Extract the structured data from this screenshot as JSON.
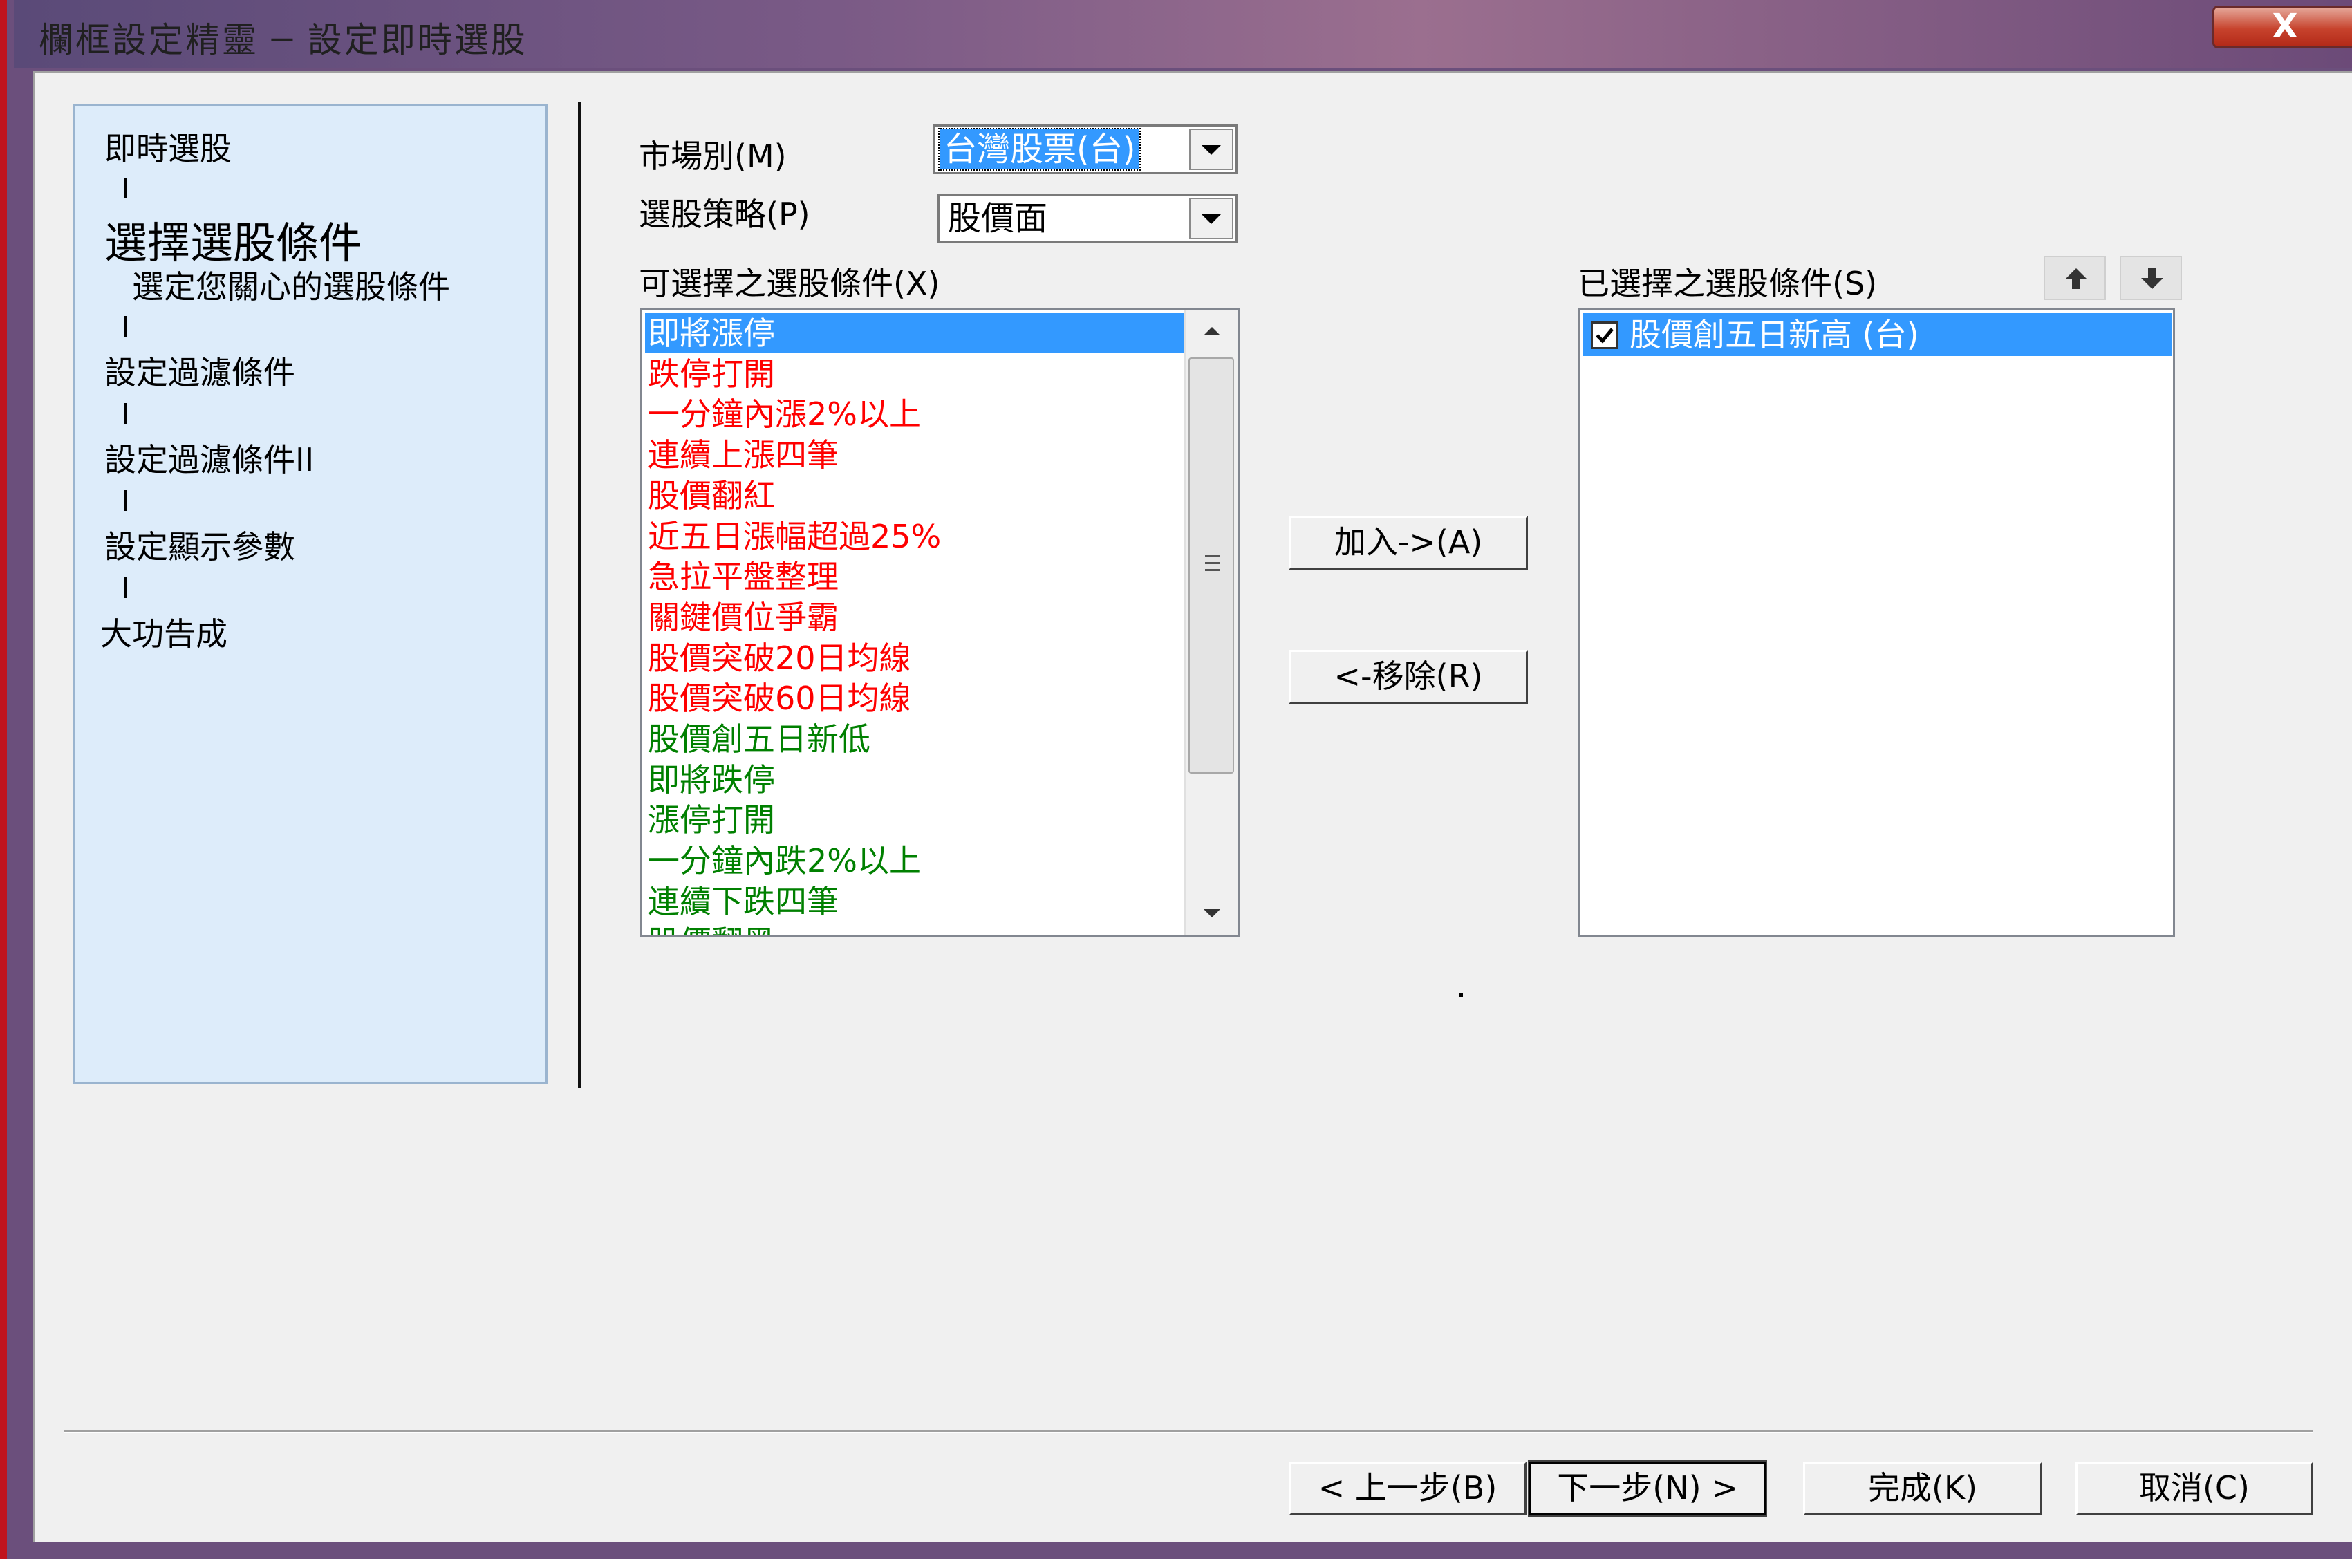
{
  "window": {
    "title": "欄框設定精靈 ─ 設定即時選股",
    "close_label": "X"
  },
  "steps": {
    "items": [
      {
        "label": "即時選股",
        "current": false
      },
      {
        "label": "選擇選股條件",
        "current": true,
        "sub": "選定您關心的選股條件"
      },
      {
        "label": "設定過濾條件",
        "current": false
      },
      {
        "label": "設定過濾條件II",
        "current": false
      },
      {
        "label": "設定顯示參數",
        "current": false
      },
      {
        "label": "大功告成",
        "current": false
      }
    ]
  },
  "form": {
    "market_label": "市場別(M)",
    "market_value": "台灣股票(台)",
    "strategy_label": "選股策略(P)",
    "strategy_value": "股價面",
    "available_label": "可選擇之選股條件(X)",
    "selected_label": "已選擇之選股條件(S)"
  },
  "available_list": [
    {
      "text": "即將漲停",
      "color": "#ff0000",
      "selected": true
    },
    {
      "text": "跌停打開",
      "color": "#ff0000"
    },
    {
      "text": "一分鐘內漲2%以上",
      "color": "#ff0000"
    },
    {
      "text": "連續上漲四筆",
      "color": "#ff0000"
    },
    {
      "text": "股價翻紅",
      "color": "#ff0000"
    },
    {
      "text": "近五日漲幅超過25%",
      "color": "#ff0000"
    },
    {
      "text": "急拉平盤整理",
      "color": "#ff0000"
    },
    {
      "text": "關鍵價位爭霸",
      "color": "#ff0000"
    },
    {
      "text": "股價突破20日均線",
      "color": "#ff0000"
    },
    {
      "text": "股價突破60日均線",
      "color": "#ff0000"
    },
    {
      "text": "股價創五日新低",
      "color": "#008000"
    },
    {
      "text": "即將跌停",
      "color": "#008000"
    },
    {
      "text": "漲停打開",
      "color": "#008000"
    },
    {
      "text": "一分鐘內跌2%以上",
      "color": "#008000"
    },
    {
      "text": "連續下跌四筆",
      "color": "#008000"
    },
    {
      "text": "股價翻黑",
      "color": "#008000"
    }
  ],
  "selected_list": [
    {
      "text": "股價創五日新高 (台)",
      "checked": true
    }
  ],
  "buttons": {
    "add": "加入->(A)",
    "remove": "<-移除(R)",
    "back": "< 上一步(B)",
    "next": "下一步(N) >",
    "finish": "完成(K)",
    "cancel": "取消(C)"
  },
  "icons": {
    "move_up": "arrow-up-icon",
    "move_down": "arrow-down-icon",
    "close": "close-icon",
    "checkbox": "checkmark-icon"
  },
  "colors": {
    "selection": "#3399ff",
    "steps_panel": "#ddecfa",
    "title_bar": "#6b4f7c",
    "rise_text": "#ff0000",
    "fall_text": "#008000"
  }
}
